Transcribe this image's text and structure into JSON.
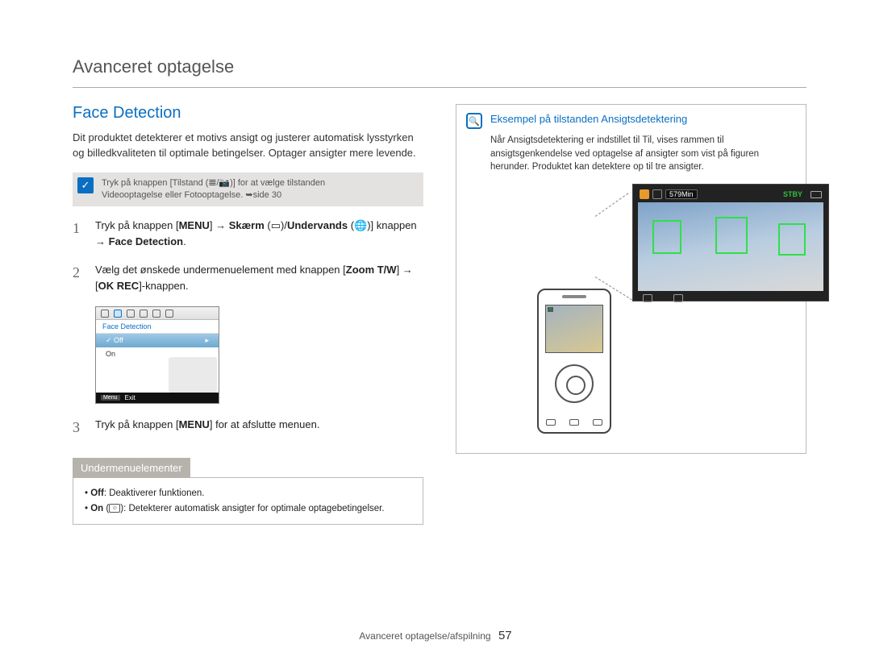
{
  "chapter_title": "Avanceret optagelse",
  "section_title": "Face Detection",
  "intro": "Dit produktet detekterer et motivs ansigt og justerer automatisk lysstyrken og billedkvaliteten til optimale betingelser. Optager ansigter mere levende.",
  "tip": {
    "line1": "Tryk på knappen [Tilstand (𝌆/📷)] for at vælge tilstanden",
    "line2": "Videooptagelse eller Fotooptagelse. ➥side 30"
  },
  "steps": [
    {
      "num": "1",
      "text_a": "Tryk på knappen [",
      "bold_a": "MENU",
      "text_b": "] → ",
      "bold_b": "Skærm",
      "text_c": " (▭)/",
      "bold_c": "Undervands",
      "text_d": " (🌐)] knappen → ",
      "bold_d": "Face Detection",
      "text_e": "."
    },
    {
      "num": "2",
      "text_a": "Vælg det ønskede undermenuelement med knappen [",
      "bold_a": "Zoom T/W",
      "text_b": "] → [",
      "bold_b": "OK REC",
      "text_c": "]-knappen."
    },
    {
      "num": "3",
      "text_a": "Tryk på knappen [",
      "bold_a": "MENU",
      "text_b": "] for at afslutte menuen."
    }
  ],
  "menu_screenshot": {
    "header": "Face Detection",
    "off": "Off",
    "on": "On",
    "menu_btn": "Menu",
    "exit": "Exit"
  },
  "sub_heading": "Undermenuelementer",
  "sub_items": {
    "off_label": "Off",
    "off_text": ": Deaktiverer funktionen.",
    "on_label": "On",
    "on_text": "): Detekterer automatisk ansigter for optimale optagebetingelser."
  },
  "example": {
    "title": "Eksempel på tilstanden Ansigtsdetektering",
    "text": "Når Ansigtsdetektering er indstillet til Til, vises rammen til ansigtsgenkendelse ved optagelse af ansigter som vist på figuren herunder. Produktet kan detektere op til tre ansigter.",
    "time_label": "579Min",
    "stby": "STBY"
  },
  "footer": {
    "text": "Avanceret optagelse/afspilning",
    "page": "57"
  }
}
